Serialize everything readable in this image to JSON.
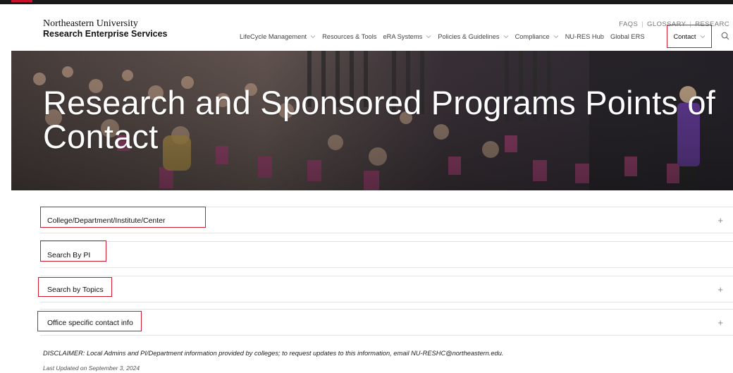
{
  "header": {
    "university": "Northeastern University",
    "department": "Research Enterprise Services",
    "utility_links": [
      "FAQS",
      "GLOSSARY",
      "RESEARC"
    ]
  },
  "nav": {
    "items": [
      {
        "label": "LifeCycle Management",
        "has_chevron": true
      },
      {
        "label": "Resources & Tools",
        "has_chevron": false
      },
      {
        "label": "eRA Systems",
        "has_chevron": true
      },
      {
        "label": "Policies & Guidelines",
        "has_chevron": true
      },
      {
        "label": "Compliance",
        "has_chevron": true
      },
      {
        "label": "NU-RES Hub",
        "has_chevron": false
      },
      {
        "label": "Global ERS",
        "has_chevron": false
      }
    ],
    "contact": "Contact",
    "search_icon": "search-icon"
  },
  "hero": {
    "title": "Research and Sponsored Programs Points of Contact"
  },
  "accordion": [
    {
      "label": "College/Department/Institute/Center",
      "expand": "+"
    },
    {
      "label": "Search By PI",
      "expand": ""
    },
    {
      "label": "Search by Topics",
      "expand": "+"
    },
    {
      "label": "Office specific contact info",
      "expand": "+"
    }
  ],
  "footer": {
    "disclaimer": "DISCLAIMER: Local Admins and PI/Department information provided by colleges; to request updates to this information, email NU-RESHC@northeastern.edu.",
    "last_updated": "Last Updated on September 3, 2024"
  },
  "colors": {
    "highlight": "#d3172c",
    "text": "#111111",
    "hero_overlay": "#3b2f3a"
  }
}
